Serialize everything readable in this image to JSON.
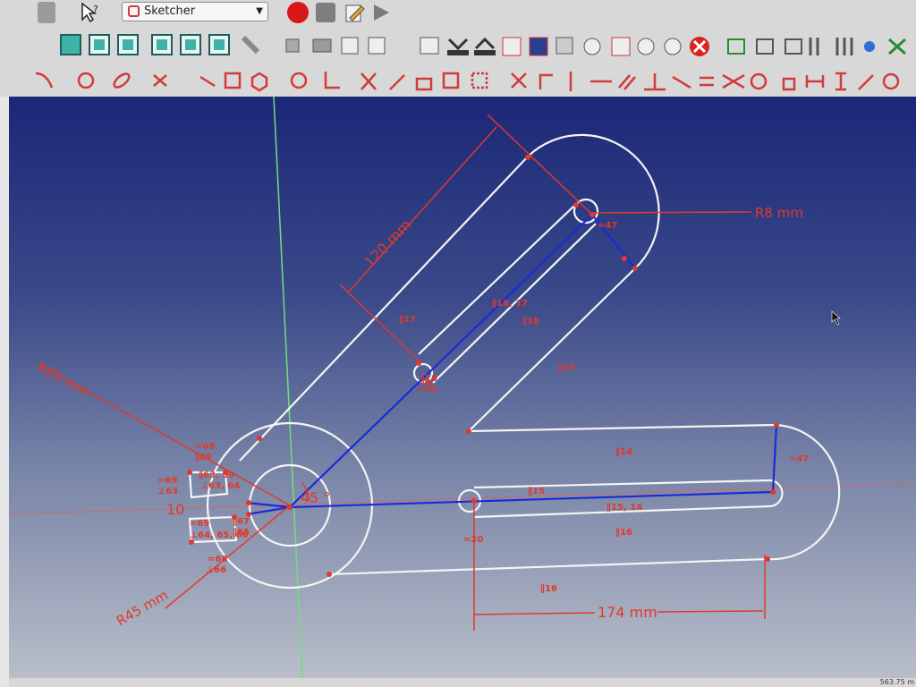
{
  "toolbar": {
    "workbench": "Sketcher"
  },
  "sketch": {
    "dimensions": {
      "length_upper": "120 mm",
      "radius_small": "R8 mm",
      "radius_25": "R25 mm",
      "radius_45": "R45 mm",
      "angle": "45 °",
      "offset": "10",
      "length_lower": "174 mm"
    },
    "constraint_labels": [
      "=47",
      "∥17",
      "∥18, 17",
      "∥18",
      "∥19",
      "∥18",
      "=20",
      "=68",
      "∥69",
      "=69",
      "⊥63",
      "∥63, 59",
      "⊥63, 64",
      "=69",
      "⊥64, 65, 66",
      "∥67",
      "∥65",
      "=68",
      "⊥66",
      "∥14",
      "=47",
      "∥15",
      "∥15, 14",
      "=20",
      "∥16",
      "∥16"
    ]
  },
  "status": {
    "coords": "563.75 m"
  }
}
